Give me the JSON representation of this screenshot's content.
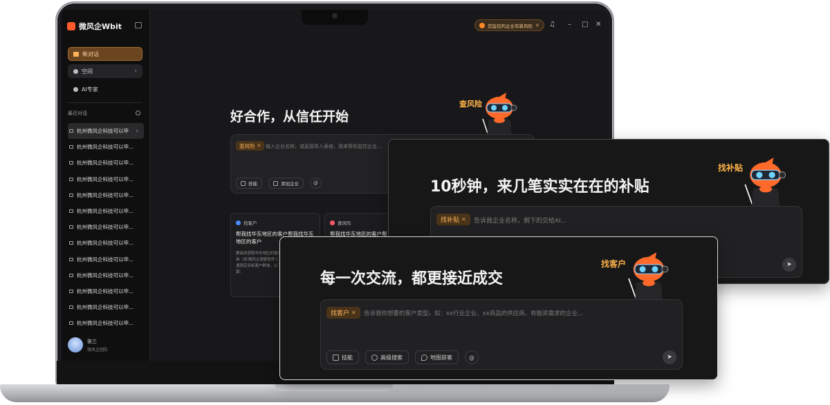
{
  "app": {
    "brand": "微风企Wbit"
  },
  "sidebar": {
    "new_chat": "新对话",
    "space": "空间",
    "ai_expert": "AI专家",
    "recent_title": "最近对话",
    "history": [
      "杭州微风企科技可以申",
      "杭州微风企科技可以申...",
      "杭州微风企科技可以申...",
      "杭州微风企科技可以申...",
      "杭州微风企科技可以申...",
      "杭州微风企科技可以申...",
      "杭州微风企科技可以申...",
      "杭州微风企科技可以申...",
      "杭州微风企科技可以申...",
      "杭州微风企科技可以申...",
      "杭州微风企科技可以申...",
      "杭州微风企科技可以申...",
      "杭州微风企科技可以申..."
    ],
    "user": {
      "name": "张三",
      "team": "微风企团队"
    }
  },
  "topbar": {
    "alert": "您监控的企业有新风险",
    "alert_close": "✕"
  },
  "main": {
    "hero": "好合作，从信任开始",
    "tag": "查风险",
    "placeholder": "输入企业名称，或直接导入表格，我来帮你监控企业...",
    "chips": {
      "skills": "技能",
      "add_company": "添加企业",
      "mention": "@"
    },
    "mascot_label": "查风险",
    "cards": [
      {
        "tag": "找客户",
        "title": "帮我找华东地区的客户帮我找华东地区的客户",
        "desc": "要高效获取华东地区的客户，可借助数字化工具（如'微风企搜索软件'）结合明确的策略，快速锁定目标客户群体。以下是具体建议和步骤："
      },
      {
        "tag": "查风险",
        "title": "帮我找华东地区的客户帮",
        "desc": ""
      }
    ]
  },
  "panel_subsidy": {
    "hero": "10秒钟，来几笔实实在在的补贴",
    "mascot_label": "找补贴",
    "tag": "找补贴",
    "placeholder": "告诉我企业名称，剩下的交给AI..."
  },
  "panel_customer": {
    "hero": "每一次交流，都更接近成交",
    "mascot_label": "找客户",
    "tag": "找客户",
    "placeholder": "告诉我你想要的客户类型。如：xx行业企业、xx商品的供应商、有融资需求的企业...",
    "chips": {
      "skills": "技能",
      "advanced_search": "高级搜索",
      "map_leads": "地图获客",
      "mention": "@"
    }
  },
  "colors": {
    "accent": "#ff8a2a",
    "tag_text": "#ffb45e",
    "panel_bg": "#171718"
  }
}
